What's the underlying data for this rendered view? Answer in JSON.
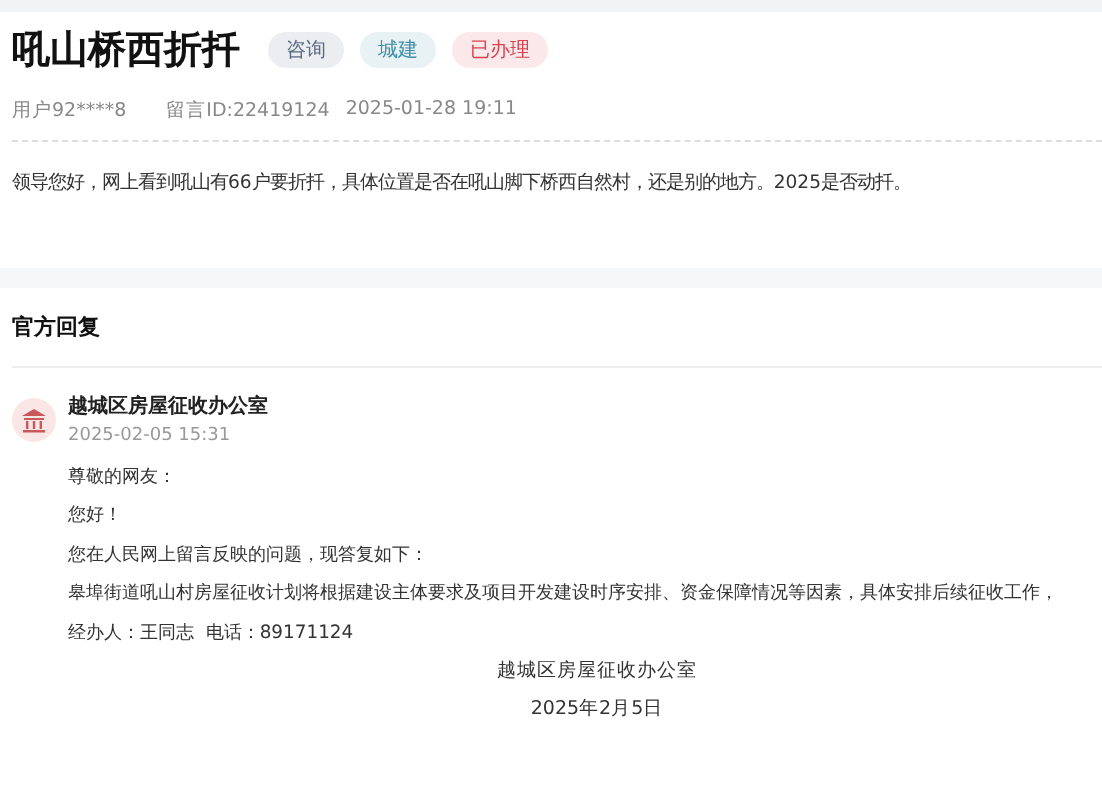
{
  "title": "吼山桥西折扦",
  "tags": [
    {
      "label": "咨询",
      "color": "#5a6b85"
    },
    {
      "label": "城建",
      "color": "#3f8fa8"
    },
    {
      "label": "已办理",
      "color": "#d9434f"
    }
  ],
  "meta": {
    "user": "用户92****8",
    "message_id": "留言ID:22419124",
    "time": "2025-01-28 19:11"
  },
  "question": "领导您好，网上看到吼山有66户要折扦，具体位置是否在吼山脚下桥西自然村，还是别的地方。2025是否动扦。",
  "reply_section": {
    "heading": "官方回复",
    "org": "越城区房屋征收办公室",
    "time": "2025-02-05 15:31",
    "lines": [
      "尊敬的网友：",
      "您好！",
      "您在人民网上留言反映的问题，现答复如下：",
      "皋埠街道吼山村房屋征收计划将根据建设主体要求及项目开发建设时序安排、资金保障情况等因素，具体安排后续征收工作，",
      "经办人：王同志  电话：89171124"
    ],
    "signature": "越城区房屋征收办公室",
    "date": "2025年2月5日"
  }
}
